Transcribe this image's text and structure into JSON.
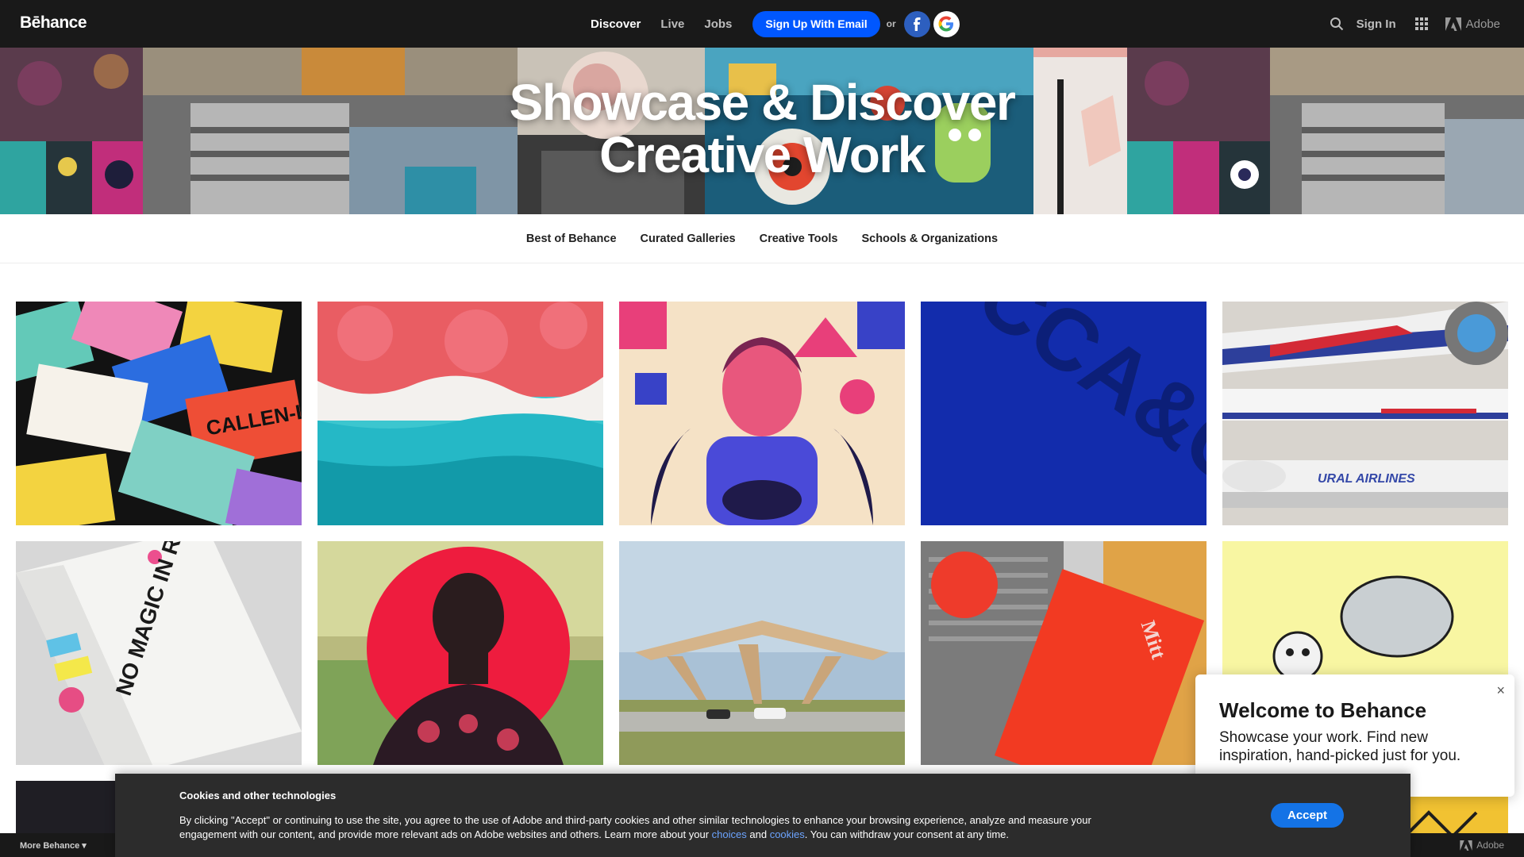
{
  "header": {
    "logo": "Bēhance",
    "nav": [
      "Discover",
      "Live",
      "Jobs"
    ],
    "signup_label": "Sign Up With Email",
    "or_label": "or",
    "signin_label": "Sign In",
    "adobe_label": "Adobe"
  },
  "hero": {
    "title_line1": "Showcase & Discover",
    "title_line2": "Creative Work"
  },
  "subnav": [
    "Best of Behance",
    "Curated Galleries",
    "Creative Tools",
    "Schools & Organizations"
  ],
  "projects": [
    {
      "name": "callen-lorde",
      "text": "CALLEN-LORDE"
    },
    {
      "name": "aerial-beach",
      "text": ""
    },
    {
      "name": "woman-illustration",
      "text": ""
    },
    {
      "name": "blue-emboss",
      "text": "CCA&C"
    },
    {
      "name": "ural-airlines",
      "text": "URAL AIRLINES"
    },
    {
      "name": "no-magic-riso-book",
      "text": "NO MAGIC IN RISO"
    },
    {
      "name": "red-sun-portrait",
      "text": ""
    },
    {
      "name": "wood-canopy",
      "text": ""
    },
    {
      "name": "mitt-card",
      "text": "Mitt"
    },
    {
      "name": "yellow-illustration",
      "text": ""
    }
  ],
  "welcome": {
    "title": "Welcome to Behance",
    "text": "Showcase your work. Find new inspiration, hand-picked just for you.",
    "close": "×"
  },
  "cookie": {
    "title": "Cookies and other technologies",
    "text_part1": "By clicking \"Accept\" or continuing to use the site, you agree to the use of Adobe and third-party cookies and other similar technologies to enhance your browsing experience, analyze and measure your engagement with our content, and provide more relevant ads on Adobe websites and others. Learn more about your",
    "link_choices": "choices",
    "and": "and",
    "link_cookies": "cookies",
    "text_part2": ". You can withdraw your consent at any time.",
    "accept_label": "Accept"
  },
  "footer": {
    "more_label": "More Behance",
    "adobe_label": "Adobe"
  },
  "colors": {
    "topbar": "#191919",
    "primary_blue": "#0057ff",
    "accept_blue": "#1473e6"
  }
}
